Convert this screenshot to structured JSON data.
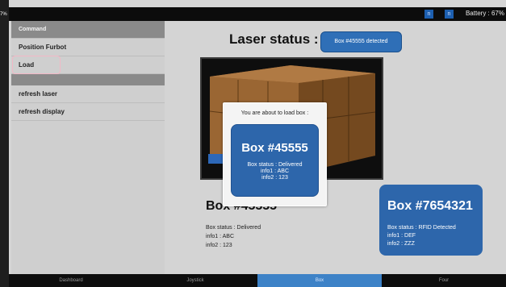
{
  "edge": {
    "left_pct": "7%"
  },
  "topbar": {
    "status_icons": [
      "n",
      "n"
    ],
    "battery": "Battery : 67%"
  },
  "sidebar": {
    "header": "Command",
    "items": [
      {
        "label": "Position Furbot"
      },
      {
        "label": "Load"
      },
      {
        "label": "refresh laser"
      },
      {
        "label": "refresh display"
      }
    ]
  },
  "main": {
    "laser_title": "Laser status :",
    "laser_badge": "Box #45555 detected",
    "photo_icon": "pallet-photo",
    "current_box": {
      "title": "Box #45555",
      "status": "Box status : Delivered",
      "info1": "info1 : ABC",
      "info2": "info2 : 123"
    },
    "other_box": {
      "title": "Box #7654321",
      "status": "Box status : RFID Detected",
      "info1": "info1 : DEF",
      "info2": "info2 : ZZZ"
    }
  },
  "modal": {
    "message": "You are about to load box :",
    "card": {
      "title": "Box #45555",
      "status": "Box status : Delivered",
      "info1": "info1 : ABC",
      "info2": "info2 : 123"
    }
  },
  "tabs": [
    {
      "label": "Dashboard"
    },
    {
      "label": "Joystick"
    },
    {
      "label": "Box"
    },
    {
      "label": "Four"
    }
  ],
  "colors": {
    "accent": "#2d66ab",
    "active_tab": "#3d82c7"
  }
}
